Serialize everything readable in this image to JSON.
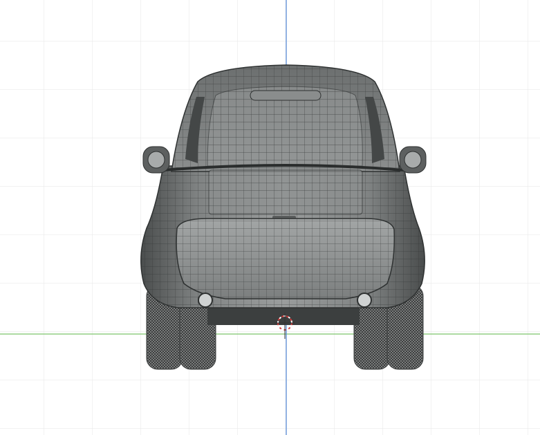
{
  "viewport": {
    "view": "front",
    "shading": "wireframe-on-shaded",
    "background_color": "#ffffff",
    "grid_color": "#e6e6e6",
    "axis_x_color": "#7cc36a",
    "axis_z_color": "#4f86d6",
    "cursor_color": "#d23a3a"
  },
  "model": {
    "icon": "car-model-icon",
    "body_color": "#7a7d7d",
    "wire_color": "#3a3d3d"
  }
}
